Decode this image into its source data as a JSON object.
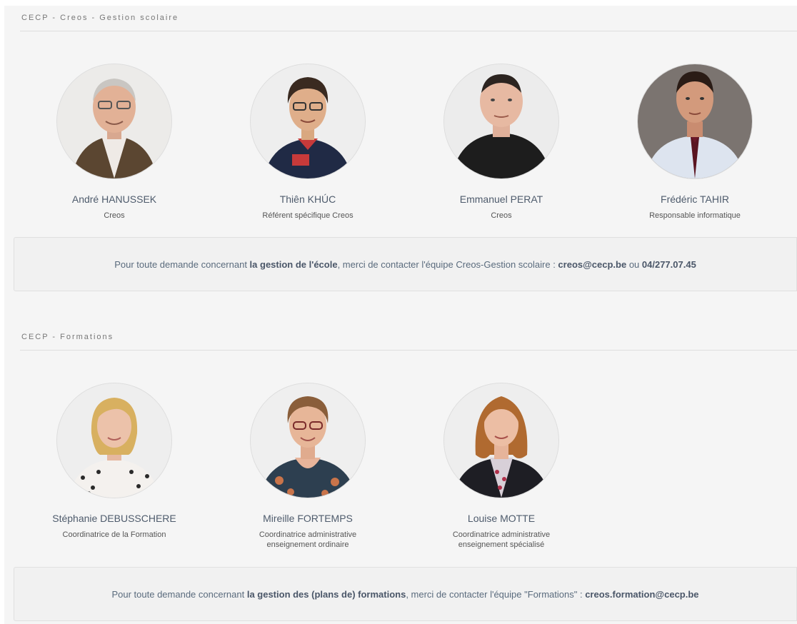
{
  "sections": [
    {
      "title": "CECP - Creos - Gestion scolaire",
      "members": [
        {
          "name": "André HANUSSEK",
          "role": "Creos"
        },
        {
          "name": "Thiên KHÚC",
          "role": "Référent spécifique Creos"
        },
        {
          "name": "Emmanuel PERAT",
          "role": "Creos"
        },
        {
          "name": "Frédéric TAHIR",
          "role": "Responsable informatique"
        }
      ],
      "notice": {
        "prefix": "Pour toute demande concernant ",
        "bold1": "la gestion de l'école",
        "middle": ", merci de contacter l'équipe Creos-Gestion scolaire : ",
        "bold2": "creos@cecp.be",
        "connector": " ou ",
        "bold3": "04/277.07.45"
      }
    },
    {
      "title": "CECP - Formations",
      "members": [
        {
          "name": "Stéphanie DEBUSSCHERE",
          "role": "Coordinatrice de la Formation"
        },
        {
          "name": "Mireille FORTEMPS",
          "role": "Coordinatrice administrative enseignement ordinaire"
        },
        {
          "name": "Louise MOTTE",
          "role": "Coordinatrice administrative enseignement spécialisé"
        }
      ],
      "notice": {
        "prefix": "Pour toute demande concernant ",
        "bold1": "la gestion des (plans de) formations",
        "middle": ", merci de contacter l'équipe \"Formations\" : ",
        "bold2": "creos.formation@cecp.be"
      }
    }
  ]
}
